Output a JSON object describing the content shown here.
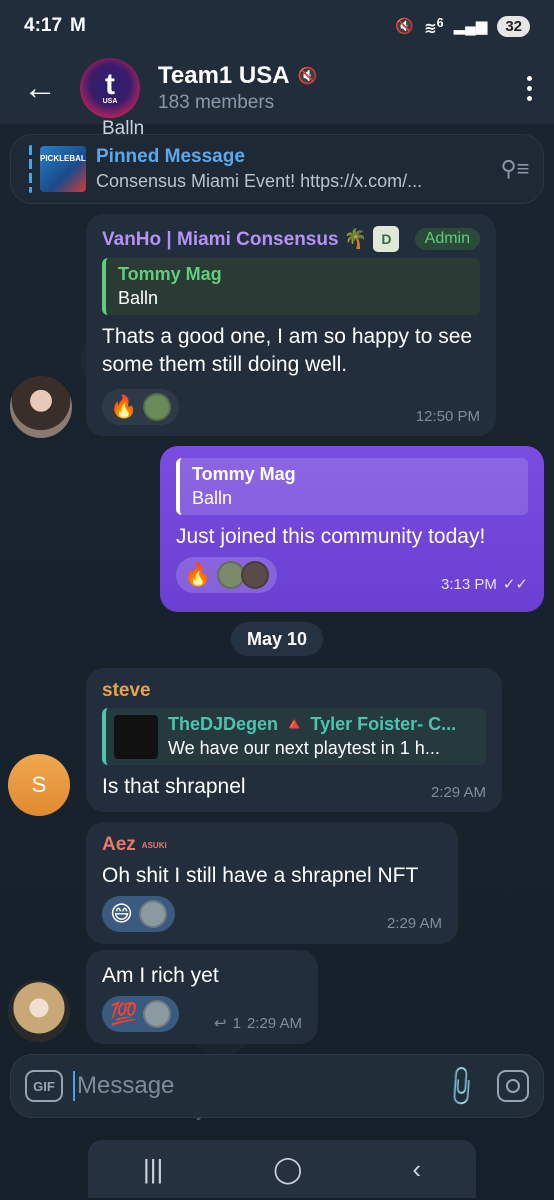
{
  "status_bar": {
    "time": "4:17",
    "carrier_icon": "gmail-icon",
    "battery": "32",
    "signal_label": "6"
  },
  "header": {
    "title": "Team1 USA",
    "subtitle": "183 members",
    "avatar_letter": "t",
    "avatar_caption": "USA"
  },
  "pinned": {
    "title": "Pinned Message",
    "text": "Consensus Miami Event! https://x.com/...",
    "thumb_caption": "PICKLEBALL"
  },
  "partial_top_text": "Balln",
  "messages": [
    {
      "sender": "VanHo | Miami Consensus 🌴",
      "badge": "Admin",
      "reply_name": "Tommy Mag",
      "reply_text": "Balln",
      "text": "Thats a good one, I am so happy to see some them still doing well.",
      "reaction": "🔥",
      "time": "12:50 PM"
    },
    {
      "reply_name": "Tommy Mag",
      "reply_text": "Balln",
      "text": "Just joined this community today!",
      "reaction": "🔥",
      "time": "3:13 PM",
      "status": "✓✓"
    },
    {
      "sender": "steve",
      "reply_name": "TheDJDegen 🔺 Tyler Foister- C...",
      "reply_text": "We have our next playtest in 1 h...",
      "text": "Is that shrapnel",
      "time": "2:29 AM",
      "avatar_letter": "S"
    },
    {
      "sender": "Aez",
      "sender_tag": "ASUKI",
      "text": "Oh shit I still have a shrapnel NFT",
      "reaction": "😄",
      "time": "2:29 AM"
    },
    {
      "text": "Am I rich yet",
      "reaction": "💯",
      "reply_count": "1",
      "time": "2:29 AM"
    }
  ],
  "date_separator": "May 10",
  "input": {
    "placeholder": "Message",
    "gif_label": "GIF"
  },
  "partial_bottom_text": "Am I rich yet",
  "colors": {
    "accent": "#5ea8ea",
    "outgoing": "#6a3fd2",
    "admin": "#5fce78",
    "vanho": "#b592f3",
    "steve": "#e9a24a",
    "aez": "#e8796c"
  }
}
